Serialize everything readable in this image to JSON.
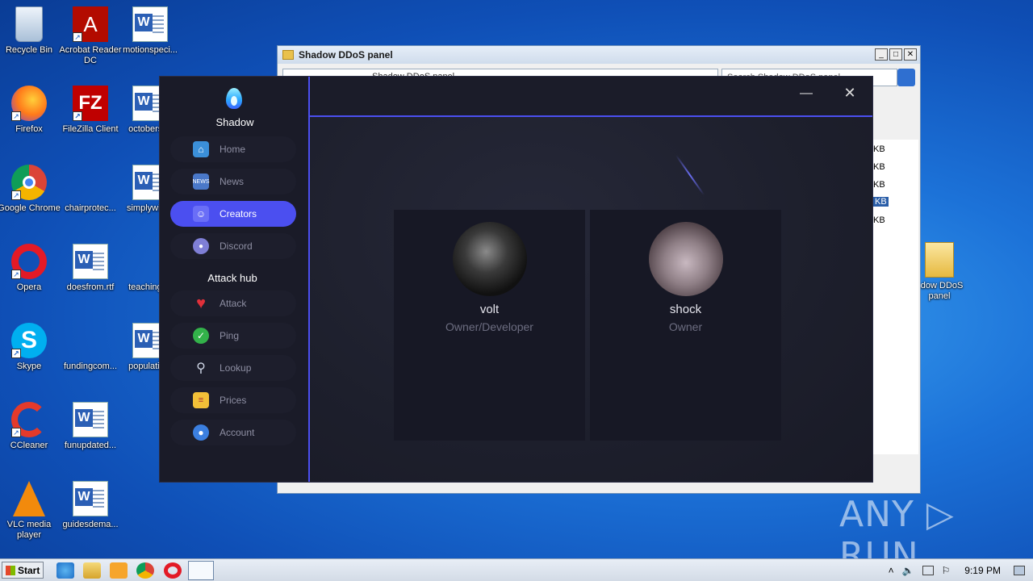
{
  "desktop": {
    "icons": [
      {
        "label": "Recycle Bin"
      },
      {
        "label": "Acrobat Reader DC"
      },
      {
        "label": "motionspeci..."
      },
      {
        "label": "Firefox"
      },
      {
        "label": "FileZilla Client"
      },
      {
        "label": "octobersi..."
      },
      {
        "label": "Google Chrome"
      },
      {
        "label": "chairprotec..."
      },
      {
        "label": "simplywilli..."
      },
      {
        "label": "Opera"
      },
      {
        "label": "doesfrom.rtf"
      },
      {
        "label": "teachingr..."
      },
      {
        "label": "Skype"
      },
      {
        "label": "fundingcom..."
      },
      {
        "label": "populatio..."
      },
      {
        "label": "CCleaner"
      },
      {
        "label": "funupdated..."
      },
      {
        "label": "VLC media player"
      },
      {
        "label": "guidesdema..."
      },
      {
        "label": "adow DDoS panel"
      }
    ]
  },
  "explorer": {
    "title": "Shadow DDoS panel",
    "address": "Shadow DDoS panel",
    "search_placeholder": "Search Shadow DDoS panel",
    "sizes": [
      "KB",
      "KB",
      "KB",
      "KB",
      "KB"
    ]
  },
  "app": {
    "brand": "Shadow",
    "nav": [
      {
        "label": "Home",
        "icon": "home-icon"
      },
      {
        "label": "News",
        "icon": "news-icon"
      },
      {
        "label": "Creators",
        "icon": "creators-icon",
        "active": true
      },
      {
        "label": "Discord",
        "icon": "discord-icon"
      }
    ],
    "section_title": "Attack hub",
    "attack_nav": [
      {
        "label": "Attack",
        "icon": "heart-icon"
      },
      {
        "label": "Ping",
        "icon": "check-icon"
      },
      {
        "label": "Lookup",
        "icon": "magnifier-icon"
      },
      {
        "label": "Prices",
        "icon": "notepad-icon"
      },
      {
        "label": "Account",
        "icon": "user-icon"
      }
    ],
    "window_controls": {
      "minimize": "—",
      "close": "✕"
    },
    "creators": [
      {
        "name": "volt",
        "role": "Owner/Developer"
      },
      {
        "name": "shock",
        "role": "Owner"
      }
    ],
    "accent_color": "#4b4ff0"
  },
  "taskbar": {
    "start_label": "Start",
    "clock": "9:19 PM"
  },
  "watermark": "ANY ▷ RUN"
}
